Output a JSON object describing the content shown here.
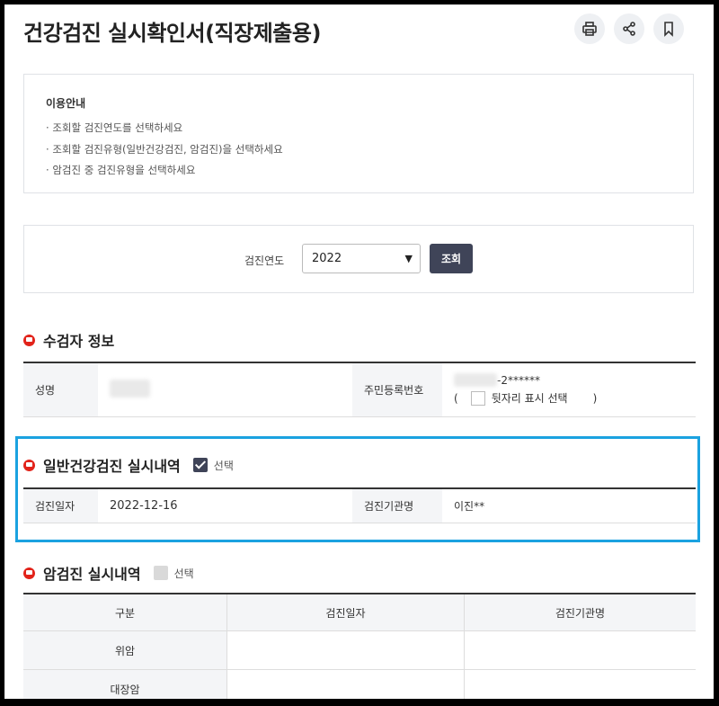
{
  "page": {
    "title": "건강검진 실시확인서(직장제출용)"
  },
  "icons": {
    "print": "print-icon",
    "share": "share-icon",
    "bookmark": "bookmark-icon"
  },
  "guide": {
    "title": "이용안내",
    "items": [
      "조회할 검진연도를 선택하세요",
      "조회할 검진유형(일반건강검진, 암검진)을 선택하세요",
      "암검진 중 검진유형을 선택하세요"
    ]
  },
  "search": {
    "year_label": "검진연도",
    "year_value": "2022",
    "button": "조회"
  },
  "examinee": {
    "title": "수검자 정보",
    "name_label": "성명",
    "rrn_label": "주민등록번호",
    "rrn_suffix": "-2******",
    "rrn_option_open": "(",
    "rrn_option_label": "뒷자리 표시 선택",
    "rrn_option_close": ")"
  },
  "general": {
    "title": "일반건강검진 실시내역",
    "select_label": "선택",
    "selected": true,
    "date_label": "검진일자",
    "date_value": "2022-12-16",
    "org_label": "검진기관명",
    "org_value": "이진**"
  },
  "cancer": {
    "title": "암검진 실시내역",
    "select_label": "선택",
    "selected": false,
    "headers": [
      "구분",
      "검진일자",
      "검진기관명"
    ],
    "rows": [
      {
        "type": "위암",
        "date": "",
        "org": ""
      },
      {
        "type": "대장암",
        "date": "",
        "org": ""
      }
    ]
  },
  "colors": {
    "accent": "#3f4458",
    "highlight": "#1ba2e0",
    "section_icon": "#e2231a"
  }
}
